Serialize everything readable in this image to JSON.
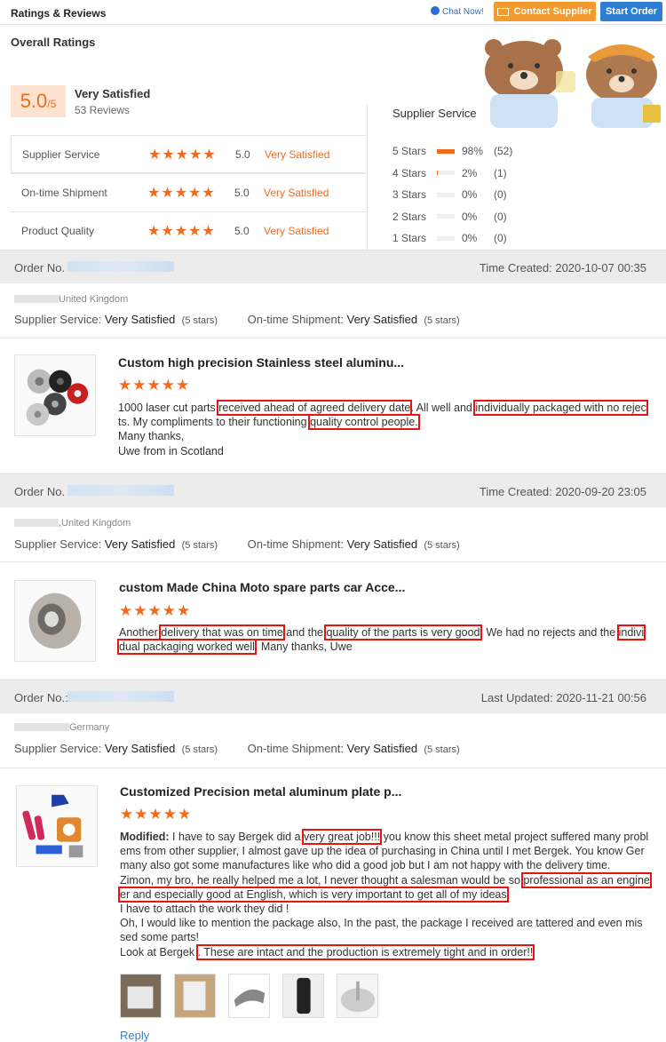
{
  "header": {
    "title": "Ratings & Reviews",
    "chat": "Chat Now!",
    "contact": "Contact Supplier",
    "start": "Start Order"
  },
  "overall": {
    "title": "Overall Ratings",
    "score": "5.0",
    "score_suffix": "/5",
    "label": "Very Satisfied",
    "reviews": "53 Reviews",
    "rows": [
      {
        "label": "Supplier Service",
        "stars": "★★★★★",
        "value": "5.0",
        "text": "Very Satisfied"
      },
      {
        "label": "On-time Shipment",
        "stars": "★★★★★",
        "value": "5.0",
        "text": "Very Satisfied"
      },
      {
        "label": "Product Quality",
        "stars": "★★★★★",
        "value": "5.0",
        "text": "Very Satisfied"
      }
    ]
  },
  "supplier_service": {
    "title": "Supplier Service",
    "distribution": [
      {
        "label": "5 Stars",
        "fraction": 0.98,
        "pct": "98%",
        "count": "(52)"
      },
      {
        "label": "4 Stars",
        "fraction": 0.02,
        "pct": "2%",
        "count": "(1)"
      },
      {
        "label": "3 Stars",
        "fraction": 0,
        "pct": "0%",
        "count": "(0)"
      },
      {
        "label": "2 Stars",
        "fraction": 0,
        "pct": "0%",
        "count": "(0)"
      },
      {
        "label": "1 Stars",
        "fraction": 0,
        "pct": "0%",
        "count": "(0)"
      }
    ]
  },
  "orders": [
    {
      "order_label": "Order No.",
      "time": "Time Created: 2020-10-07 00:35",
      "country": "United Kingdom",
      "ss_label": "Supplier Service:",
      "ss_value": "Very Satisfied",
      "ss_stars": "(5 stars)",
      "os_label": "On-time Shipment:",
      "os_value": "Very Satisfied",
      "os_stars": "(5 stars)",
      "product": "Custom high precision Stainless steel aluminu...",
      "stars": "★★★★★",
      "text": {
        "a": "1000 laser cut parts ",
        "h1": "received ahead of agreed delivery date",
        "b": ". All well and ",
        "h2": "individually packaged with no rejec",
        "c": "ts.  My compliments to their functioning ",
        "h3": "quality control people.",
        "d": "Many thanks,",
        "e": "Uwe from in Scotland"
      }
    },
    {
      "order_label": "Order No.",
      "time": "Time Created: 2020-09-20 23:05",
      "country": ",United Kingdom",
      "ss_label": "Supplier Service:",
      "ss_value": "Very Satisfied",
      "ss_stars": "(5 stars)",
      "os_label": "On-time Shipment:",
      "os_value": "Very Satisfied",
      "os_stars": "(5 stars)",
      "product": "custom Made China Moto spare parts car Acce...",
      "stars": "★★★★★",
      "text": {
        "a": "Another ",
        "h1": "delivery that was on time",
        "b": " and the ",
        "h2": "quality of the parts is very good",
        "c": ". We had no rejects and the ",
        "h3a": "indivi",
        "h3b": "dual packaging worked well",
        "d": ". Many thanks, Uwe"
      }
    },
    {
      "order_label": "Order No.:",
      "time": "Last Updated: 2020-11-21 00:56",
      "country": "Germany",
      "ss_label": "Supplier Service:",
      "ss_value": "Very Satisfied",
      "ss_stars": "(5 stars)",
      "os_label": "On-time Shipment:",
      "os_value": "Very Satisfied",
      "os_stars": "(5 stars)",
      "product": "Customized Precision metal aluminum plate p...",
      "stars": "★★★★★",
      "text": {
        "mod": "Modified:",
        "a": " I have to say Bergek did a ",
        "h1": "very great job!!!",
        "b": " you know this sheet metal project suffered many probl",
        "c": "ems from other supplier, I almost gave up the idea of purchasing in China until I met Bergek.  You know Ger",
        "d": "many also got some manufactures like who did a good job but I am not happy with the delivery time.",
        "e": "Zimon, my bro, he really helped me a lot, I never thought a salesman would be so ",
        "h2a": "professional as an engine",
        "h2b": "er and especially good at English, which is very important to get all of my ideas",
        "f": "I have to attach the work they did !",
        "g": "Oh, I would like to mention the package also,  In the past,  the package I received are tattered and even mis",
        "h": "sed some parts!",
        "i": "Look at Bergek ",
        "h3": ". These are intact and the production is extremely tight and in order!!"
      },
      "reply": "Reply"
    }
  ]
}
